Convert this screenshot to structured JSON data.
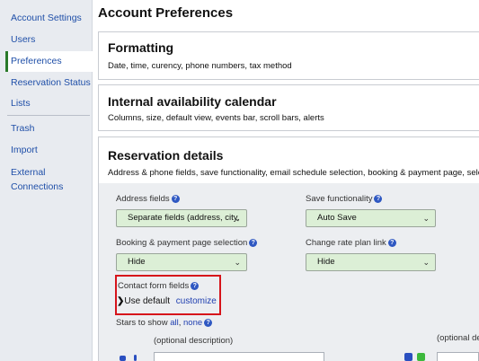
{
  "sidebar": {
    "items": [
      {
        "label": "Account Settings"
      },
      {
        "label": "Users"
      },
      {
        "label": "Preferences"
      },
      {
        "label": "Reservation Status"
      },
      {
        "label": "Lists"
      },
      {
        "label": "Trash"
      },
      {
        "label": "Import"
      },
      {
        "label": "External Connections"
      }
    ],
    "active_index": 2
  },
  "main": {
    "title": "Account Preferences",
    "sections": [
      {
        "title": "Formatting",
        "desc": "Date, time, curency, phone numbers, tax method"
      },
      {
        "title": "Internal availability calendar",
        "desc": "Columns, size, default view, events bar, scroll bars, alerts"
      },
      {
        "title": "Reservation details",
        "desc": "Address & phone fields, save functionality, email schedule selection, booking & payment page, selectio"
      }
    ],
    "fields": {
      "address": {
        "label": "Address fields",
        "value": "Separate fields (address, city,"
      },
      "save": {
        "label": "Save functionality",
        "value": "Auto Save"
      },
      "booking": {
        "label": "Booking & payment page selection",
        "value": "Hide"
      },
      "change_rate": {
        "label": "Change rate plan link",
        "value": "Hide"
      },
      "contact": {
        "label": "Contact form fields",
        "use_default": "Use default",
        "customize": "customize"
      },
      "stars": {
        "label": "Stars to show",
        "all": "all",
        "sep": ",",
        "none": "none"
      },
      "optional_desc_1": "(optional description)",
      "optional_desc_2": "(optional de"
    },
    "help_glyph": "?",
    "chevron_glyph": "⌄",
    "colors": {
      "link": "#1f4fa8",
      "select_bg": "#dcefd6",
      "highlight": "#d6141b",
      "active_border": "#2a7a2a"
    }
  }
}
